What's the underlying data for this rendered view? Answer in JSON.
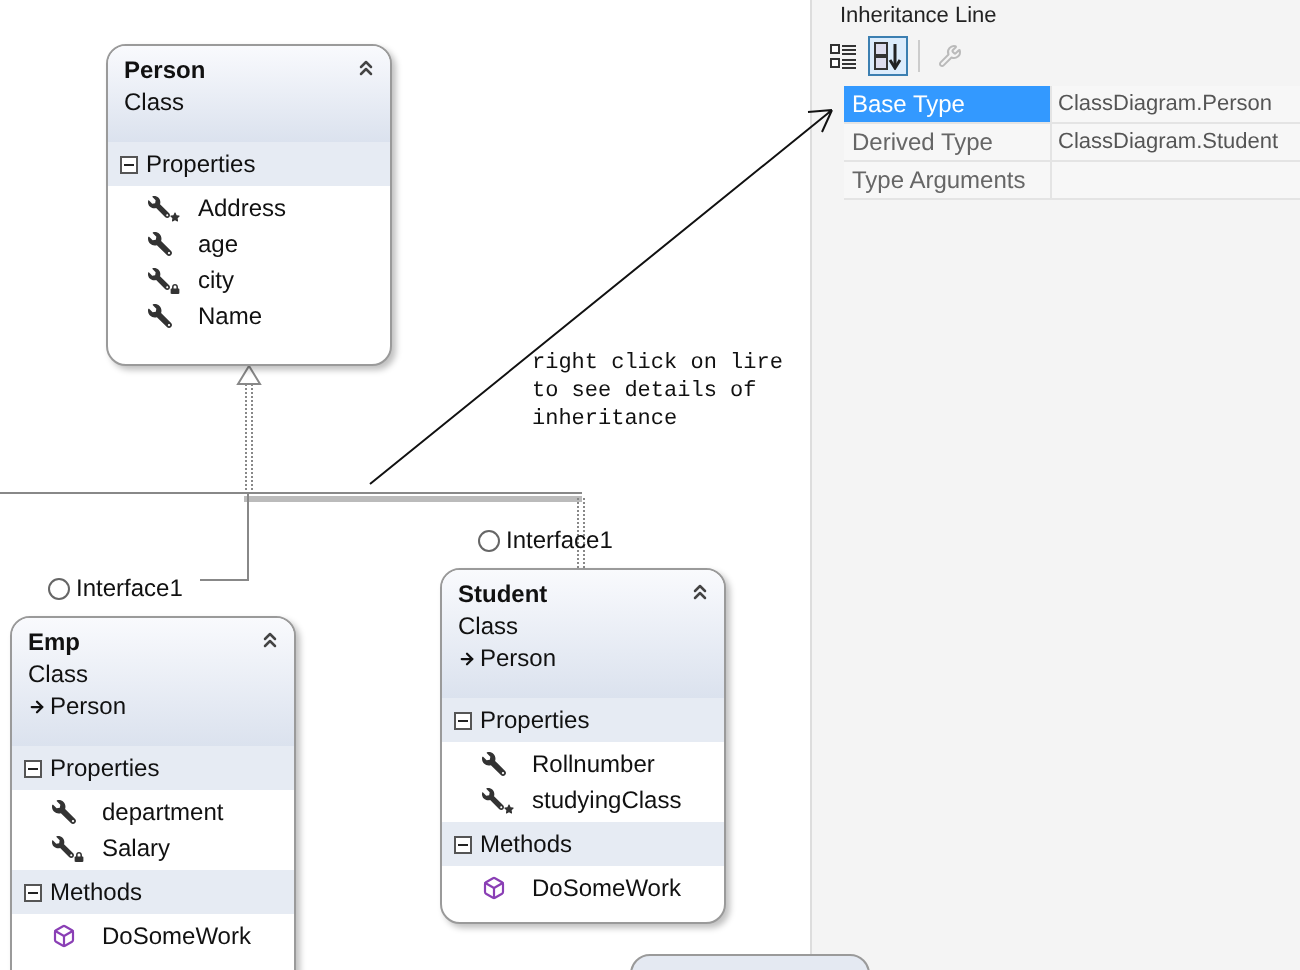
{
  "diagram": {
    "classes": [
      {
        "name": "Person",
        "type": "Class",
        "expanded": true,
        "sections": [
          {
            "title": "Properties",
            "expanded": true,
            "members": [
              {
                "name": "Address",
                "kind": "property-star"
              },
              {
                "name": "age",
                "kind": "property"
              },
              {
                "name": "city",
                "kind": "property-lock"
              },
              {
                "name": "Name",
                "kind": "property"
              }
            ]
          }
        ]
      },
      {
        "name": "Emp",
        "type": "Class",
        "base": "Person",
        "expanded": true,
        "interface": "Interface1",
        "sections": [
          {
            "title": "Properties",
            "expanded": true,
            "members": [
              {
                "name": "department",
                "kind": "property"
              },
              {
                "name": "Salary",
                "kind": "property-lock"
              }
            ]
          },
          {
            "title": "Methods",
            "expanded": true,
            "members": [
              {
                "name": "DoSomeWork",
                "kind": "method"
              }
            ]
          }
        ]
      },
      {
        "name": "Student",
        "type": "Class",
        "base": "Person",
        "expanded": true,
        "interface": "Interface1",
        "sections": [
          {
            "title": "Properties",
            "expanded": true,
            "members": [
              {
                "name": "Rollnumber",
                "kind": "property"
              },
              {
                "name": "studyingClass",
                "kind": "property-star"
              }
            ]
          },
          {
            "title": "Methods",
            "expanded": true,
            "members": [
              {
                "name": "DoSomeWork",
                "kind": "method"
              }
            ]
          }
        ]
      }
    ],
    "annotation": "right click on lire\nto see details of\ninheritance"
  },
  "properties_panel": {
    "title": "Inheritance Line",
    "toolbar": [
      {
        "kind": "categorized",
        "selected": false,
        "disabled": false
      },
      {
        "kind": "alphabetical",
        "selected": true,
        "disabled": false
      },
      {
        "kind": "property-pages",
        "selected": false,
        "disabled": true
      }
    ],
    "rows": [
      {
        "name": "Base Type",
        "value": "ClassDiagram.Person",
        "selected": true
      },
      {
        "name": "Derived Type",
        "value": "ClassDiagram.Student",
        "selected": false
      },
      {
        "name": "Type Arguments",
        "value": null,
        "selected": false
      }
    ]
  }
}
